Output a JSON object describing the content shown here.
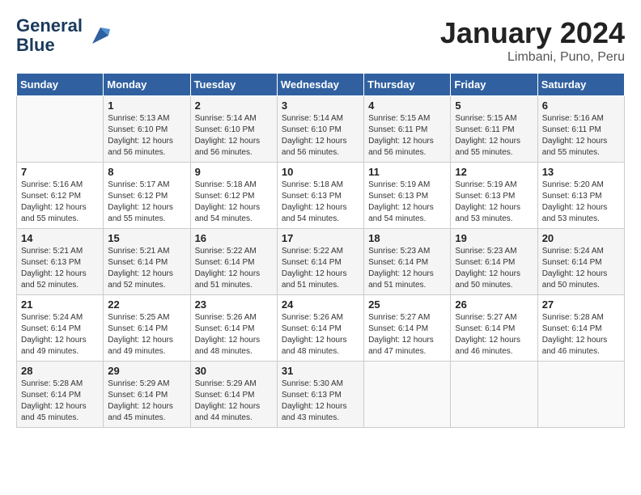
{
  "header": {
    "logo_line1": "General",
    "logo_line2": "Blue",
    "month": "January 2024",
    "location": "Limbani, Puno, Peru"
  },
  "weekdays": [
    "Sunday",
    "Monday",
    "Tuesday",
    "Wednesday",
    "Thursday",
    "Friday",
    "Saturday"
  ],
  "weeks": [
    [
      {
        "day": "",
        "info": ""
      },
      {
        "day": "1",
        "info": "Sunrise: 5:13 AM\nSunset: 6:10 PM\nDaylight: 12 hours\nand 56 minutes."
      },
      {
        "day": "2",
        "info": "Sunrise: 5:14 AM\nSunset: 6:10 PM\nDaylight: 12 hours\nand 56 minutes."
      },
      {
        "day": "3",
        "info": "Sunrise: 5:14 AM\nSunset: 6:10 PM\nDaylight: 12 hours\nand 56 minutes."
      },
      {
        "day": "4",
        "info": "Sunrise: 5:15 AM\nSunset: 6:11 PM\nDaylight: 12 hours\nand 56 minutes."
      },
      {
        "day": "5",
        "info": "Sunrise: 5:15 AM\nSunset: 6:11 PM\nDaylight: 12 hours\nand 55 minutes."
      },
      {
        "day": "6",
        "info": "Sunrise: 5:16 AM\nSunset: 6:11 PM\nDaylight: 12 hours\nand 55 minutes."
      }
    ],
    [
      {
        "day": "7",
        "info": "Sunrise: 5:16 AM\nSunset: 6:12 PM\nDaylight: 12 hours\nand 55 minutes."
      },
      {
        "day": "8",
        "info": "Sunrise: 5:17 AM\nSunset: 6:12 PM\nDaylight: 12 hours\nand 55 minutes."
      },
      {
        "day": "9",
        "info": "Sunrise: 5:18 AM\nSunset: 6:12 PM\nDaylight: 12 hours\nand 54 minutes."
      },
      {
        "day": "10",
        "info": "Sunrise: 5:18 AM\nSunset: 6:13 PM\nDaylight: 12 hours\nand 54 minutes."
      },
      {
        "day": "11",
        "info": "Sunrise: 5:19 AM\nSunset: 6:13 PM\nDaylight: 12 hours\nand 54 minutes."
      },
      {
        "day": "12",
        "info": "Sunrise: 5:19 AM\nSunset: 6:13 PM\nDaylight: 12 hours\nand 53 minutes."
      },
      {
        "day": "13",
        "info": "Sunrise: 5:20 AM\nSunset: 6:13 PM\nDaylight: 12 hours\nand 53 minutes."
      }
    ],
    [
      {
        "day": "14",
        "info": "Sunrise: 5:21 AM\nSunset: 6:13 PM\nDaylight: 12 hours\nand 52 minutes."
      },
      {
        "day": "15",
        "info": "Sunrise: 5:21 AM\nSunset: 6:14 PM\nDaylight: 12 hours\nand 52 minutes."
      },
      {
        "day": "16",
        "info": "Sunrise: 5:22 AM\nSunset: 6:14 PM\nDaylight: 12 hours\nand 51 minutes."
      },
      {
        "day": "17",
        "info": "Sunrise: 5:22 AM\nSunset: 6:14 PM\nDaylight: 12 hours\nand 51 minutes."
      },
      {
        "day": "18",
        "info": "Sunrise: 5:23 AM\nSunset: 6:14 PM\nDaylight: 12 hours\nand 51 minutes."
      },
      {
        "day": "19",
        "info": "Sunrise: 5:23 AM\nSunset: 6:14 PM\nDaylight: 12 hours\nand 50 minutes."
      },
      {
        "day": "20",
        "info": "Sunrise: 5:24 AM\nSunset: 6:14 PM\nDaylight: 12 hours\nand 50 minutes."
      }
    ],
    [
      {
        "day": "21",
        "info": "Sunrise: 5:24 AM\nSunset: 6:14 PM\nDaylight: 12 hours\nand 49 minutes."
      },
      {
        "day": "22",
        "info": "Sunrise: 5:25 AM\nSunset: 6:14 PM\nDaylight: 12 hours\nand 49 minutes."
      },
      {
        "day": "23",
        "info": "Sunrise: 5:26 AM\nSunset: 6:14 PM\nDaylight: 12 hours\nand 48 minutes."
      },
      {
        "day": "24",
        "info": "Sunrise: 5:26 AM\nSunset: 6:14 PM\nDaylight: 12 hours\nand 48 minutes."
      },
      {
        "day": "25",
        "info": "Sunrise: 5:27 AM\nSunset: 6:14 PM\nDaylight: 12 hours\nand 47 minutes."
      },
      {
        "day": "26",
        "info": "Sunrise: 5:27 AM\nSunset: 6:14 PM\nDaylight: 12 hours\nand 46 minutes."
      },
      {
        "day": "27",
        "info": "Sunrise: 5:28 AM\nSunset: 6:14 PM\nDaylight: 12 hours\nand 46 minutes."
      }
    ],
    [
      {
        "day": "28",
        "info": "Sunrise: 5:28 AM\nSunset: 6:14 PM\nDaylight: 12 hours\nand 45 minutes."
      },
      {
        "day": "29",
        "info": "Sunrise: 5:29 AM\nSunset: 6:14 PM\nDaylight: 12 hours\nand 45 minutes."
      },
      {
        "day": "30",
        "info": "Sunrise: 5:29 AM\nSunset: 6:14 PM\nDaylight: 12 hours\nand 44 minutes."
      },
      {
        "day": "31",
        "info": "Sunrise: 5:30 AM\nSunset: 6:13 PM\nDaylight: 12 hours\nand 43 minutes."
      },
      {
        "day": "",
        "info": ""
      },
      {
        "day": "",
        "info": ""
      },
      {
        "day": "",
        "info": ""
      }
    ]
  ]
}
